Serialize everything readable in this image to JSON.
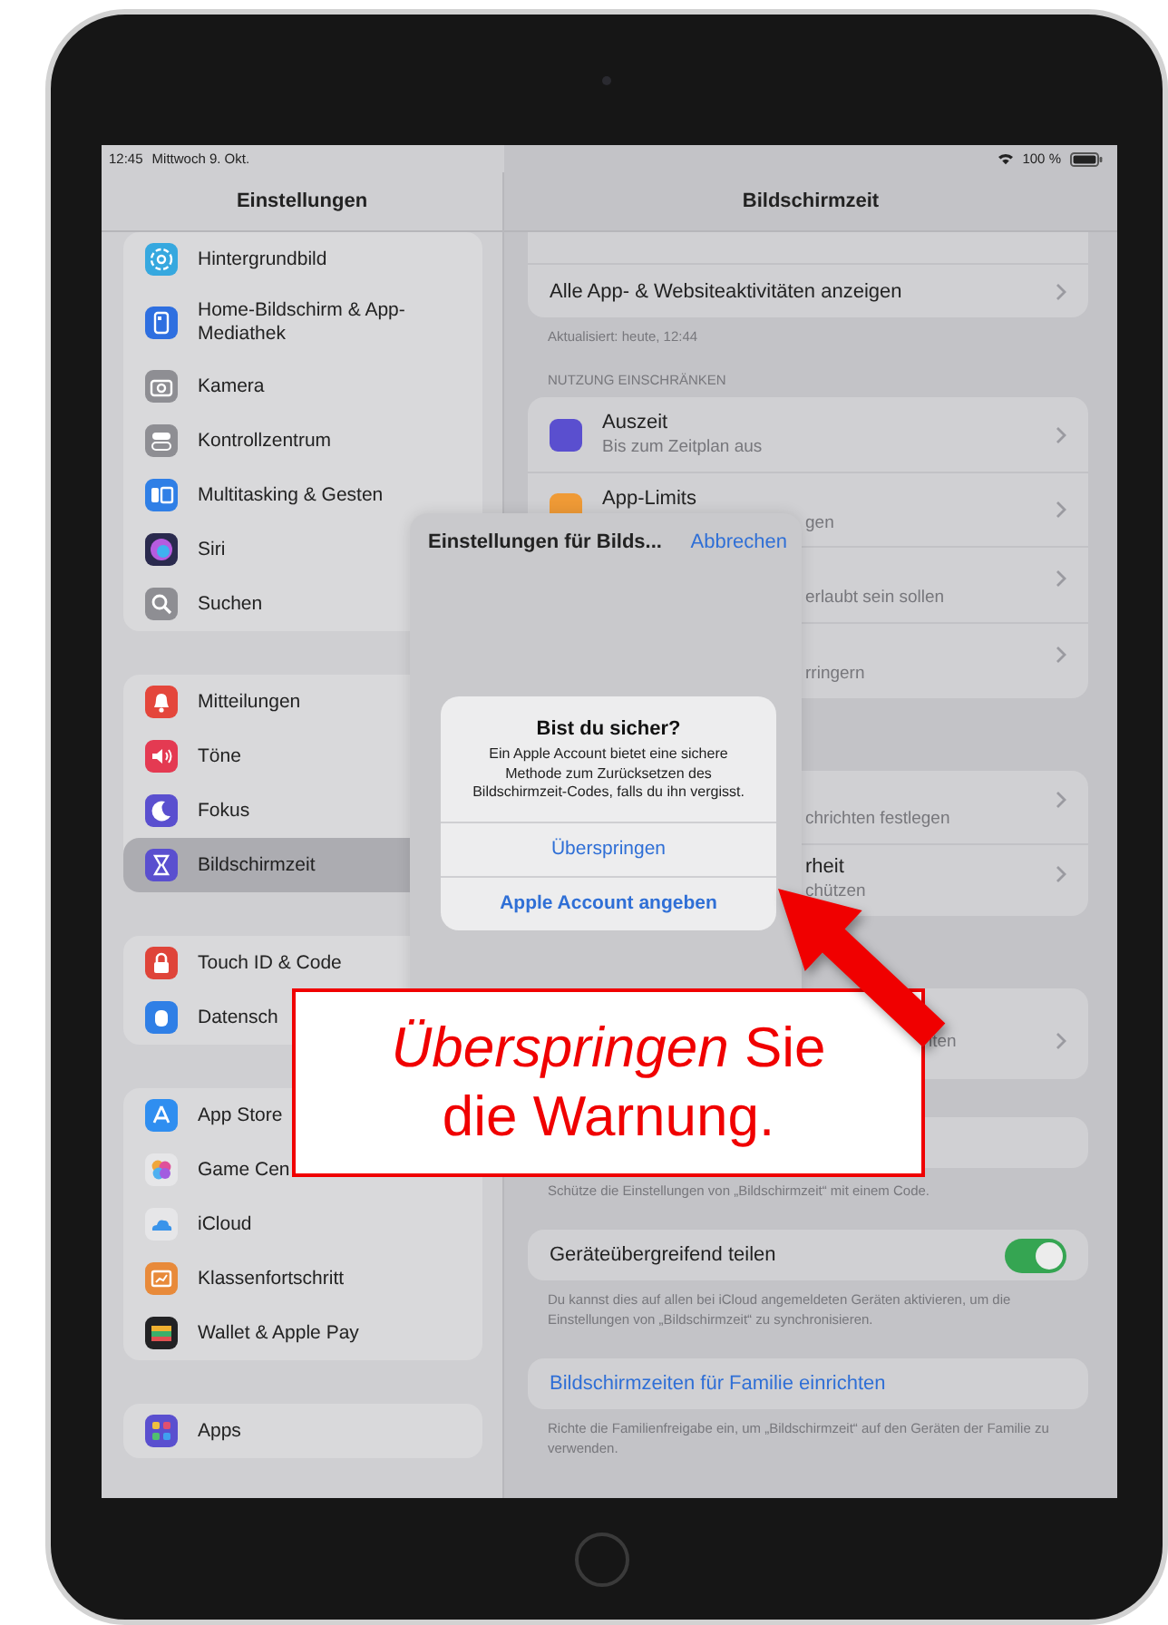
{
  "status_bar": {
    "time": "12:45",
    "date": "Mittwoch 9. Okt.",
    "battery": "100 %"
  },
  "sidebar": {
    "title": "Einstellungen",
    "groups": [
      {
        "items": [
          {
            "label": "Hintergrundbild",
            "kind": "flower",
            "color": "#36a8df",
            "selected": false
          },
          {
            "label": "Home-Bildschirm & App-Mediathek",
            "kind": "homescreen",
            "color": "#2e6fe0",
            "selected": false
          },
          {
            "label": "Kamera",
            "kind": "camera",
            "color": "#8e8e93",
            "selected": false
          },
          {
            "label": "Kontrollzentrum",
            "kind": "toggles",
            "color": "#8e8e93",
            "selected": false
          },
          {
            "label": "Multitasking & Gesten",
            "kind": "multitask",
            "color": "#2f7fe6",
            "selected": false
          },
          {
            "label": "Siri",
            "kind": "siri",
            "color": "#2a2a4e",
            "selected": false
          },
          {
            "label": "Suchen",
            "kind": "search",
            "color": "#8e8e93",
            "selected": false
          }
        ]
      },
      {
        "items": [
          {
            "label": "Mitteilungen",
            "kind": "bell",
            "color": "#e4463b",
            "selected": false
          },
          {
            "label": "Töne",
            "kind": "speaker",
            "color": "#e43a52",
            "selected": false
          },
          {
            "label": "Fokus",
            "kind": "moon",
            "color": "#5a4fcf",
            "selected": false
          },
          {
            "label": "Bildschirmzeit",
            "kind": "hourglass",
            "color": "#5a4fcf",
            "selected": true
          }
        ]
      },
      {
        "items": [
          {
            "label": "Touch ID & Code",
            "kind": "lock",
            "color": "#df4439",
            "selected": false
          },
          {
            "label": "Datensch",
            "kind": "hand",
            "color": "#2f7fe6",
            "selected": false
          }
        ]
      },
      {
        "items": [
          {
            "label": "App Store",
            "kind": "appstore",
            "color": "#2f8ef0",
            "selected": false
          },
          {
            "label": "Game Cen",
            "kind": "gamecenter",
            "color": "#e6e6e8",
            "selected": false
          },
          {
            "label": "iCloud",
            "kind": "cloud",
            "color": "#e6e6e8",
            "selected": false
          },
          {
            "label": "Klassenfortschritt",
            "kind": "progress",
            "color": "#e88a3a",
            "selected": false
          },
          {
            "label": "Wallet & Apple Pay",
            "kind": "wallet",
            "color": "#222224",
            "selected": false
          }
        ]
      },
      {
        "items": [
          {
            "label": "Apps",
            "kind": "apps",
            "color": "#5a4fcf",
            "selected": false
          }
        ]
      }
    ]
  },
  "detail": {
    "title": "Bildschirmzeit",
    "sections": [
      {
        "rows": [
          {
            "kind": "nav",
            "title": "Alle App- & Websiteaktivitäten anzeigen"
          }
        ],
        "footer": "Aktualisiert: heute, 12:44"
      },
      {
        "header": "NUTZUNG EINSCHRÄNKEN",
        "rows": [
          {
            "kind": "icon_nav",
            "title": "Auszeit",
            "subtitle": "Bis zum Zeitplan aus",
            "color": "#5a4fcf"
          },
          {
            "kind": "icon_partial",
            "title": "App-Limits",
            "subtitle": "gen",
            "color": "#ef9a36"
          },
          {
            "kind": "partial",
            "subtitle": "erlaubt sein sollen"
          },
          {
            "kind": "partial",
            "subtitle": "rringern"
          }
        ]
      },
      {
        "rows": [
          {
            "kind": "partial",
            "subtitle": "chrichten festlegen"
          },
          {
            "kind": "partial",
            "title": "rheit",
            "subtitle": "chützen"
          }
        ]
      },
      {
        "rows": [
          {
            "kind": "partial_wide",
            "subtitle": "lten"
          }
        ]
      },
      {
        "rows": [
          {
            "kind": "blank"
          }
        ],
        "footer": "Schütze die Einstellungen von „Bildschirmzeit“ mit einem Code."
      },
      {
        "rows": [
          {
            "kind": "toggle",
            "title": "Geräteübergreifend teilen",
            "on": true
          }
        ],
        "footer": "Du kannst dies auf allen bei iCloud angemeldeten Geräten aktivieren, um die Einstellungen von „Bildschirmzeit“ zu synchronisieren."
      },
      {
        "rows": [
          {
            "kind": "action",
            "title": "Bildschirmzeiten für Familie einrichten"
          }
        ],
        "footer": "Richte die Familienfreigabe ein, um „Bildschirmzeit“ auf den Geräten der Familie zu verwenden."
      }
    ]
  },
  "sheet": {
    "title": "Einstellungen für Bilds...",
    "cancel": "Abbrechen"
  },
  "alert": {
    "title": "Bist du sicher?",
    "message": "Ein Apple Account bietet eine sichere Methode zum Zurücksetzen des Bildschirmzeit-Codes, falls du ihn vergisst.",
    "buttons": [
      {
        "label": "Überspringen",
        "kind": "default"
      },
      {
        "label": "Apple Account angeben",
        "kind": "preferred"
      }
    ]
  },
  "callout": {
    "text": "*Überspringen* Sie die Warnung."
  }
}
